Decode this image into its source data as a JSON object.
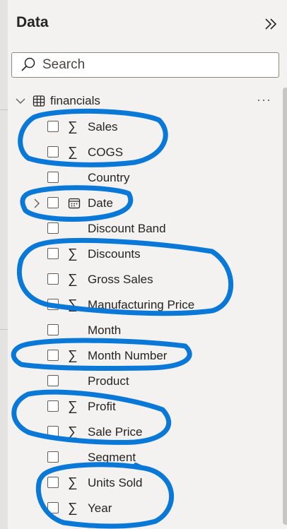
{
  "pane": {
    "title": "Data",
    "collapse_icon": "double-chevron-right-icon"
  },
  "search": {
    "placeholder": "Search",
    "icon": "search-icon"
  },
  "table": {
    "name": "financials",
    "more_label": "···",
    "expanded": true
  },
  "fields": [
    {
      "name": "Sales",
      "icon": "sigma"
    },
    {
      "name": "COGS",
      "icon": "sigma"
    },
    {
      "name": "Country",
      "icon": "none"
    },
    {
      "name": "Date",
      "icon": "calendar"
    },
    {
      "name": "Discount Band",
      "icon": "none"
    },
    {
      "name": "Discounts",
      "icon": "sigma"
    },
    {
      "name": "Gross Sales",
      "icon": "sigma"
    },
    {
      "name": "Manufacturing Price",
      "icon": "sigma"
    },
    {
      "name": "Month",
      "icon": "none"
    },
    {
      "name": "Month Number",
      "icon": "sigma"
    },
    {
      "name": "Product",
      "icon": "none"
    },
    {
      "name": "Profit",
      "icon": "sigma"
    },
    {
      "name": "Sale Price",
      "icon": "sigma"
    },
    {
      "name": "Segment",
      "icon": "none"
    },
    {
      "name": "Units Sold",
      "icon": "sigma"
    },
    {
      "name": "Year",
      "icon": "sigma"
    }
  ],
  "colors": {
    "annotation": "#0a78d7",
    "pane_bg": "#f3f2f1",
    "text": "#252423"
  }
}
